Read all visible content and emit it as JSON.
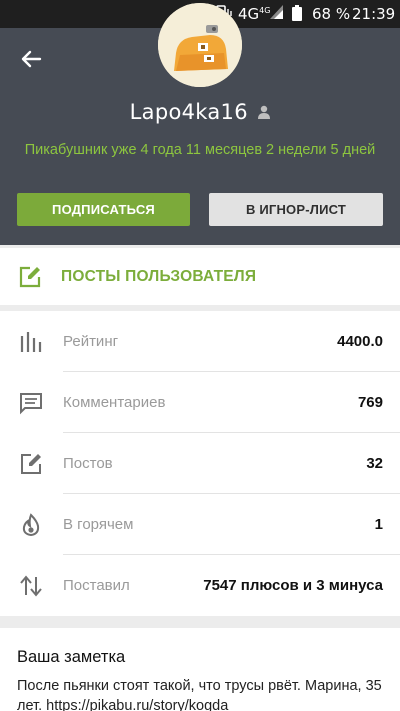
{
  "status_bar": {
    "network": "4G",
    "network_sup": "4G",
    "battery": "68 %",
    "time": "21:39"
  },
  "profile": {
    "username": "Lapo4ka16",
    "tenure": "Пикабушник уже 4 года 11 месяцев 2 недели 5 дней",
    "subscribe_label": "ПОДПИСАТЬСЯ",
    "ignore_label": "В ИГНОР-ЛИСТ"
  },
  "posts_link": {
    "label": "ПОСТЫ ПОЛЬЗОВАТЕЛЯ"
  },
  "stats": [
    {
      "icon": "rating-bars-icon",
      "label": "Рейтинг",
      "value": "4400.0"
    },
    {
      "icon": "comment-icon",
      "label": "Комментариев",
      "value": "769"
    },
    {
      "icon": "edit-icon",
      "label": "Постов",
      "value": "32"
    },
    {
      "icon": "flame-icon",
      "label": "В горячем",
      "value": "1"
    },
    {
      "icon": "updown-arrows-icon",
      "label": "Поставил",
      "value": "7547 плюсов и 3 минуса"
    }
  ],
  "note": {
    "title": "Ваша заметка",
    "text": "После пьянки стоят такой, что трусы рвёт. Марина, 35 лет. https://pikabu.ru/story/kogda"
  },
  "colors": {
    "header_bg": "#464b54",
    "accent_green": "#7caa3a",
    "tenure_green": "#8dc63f"
  }
}
